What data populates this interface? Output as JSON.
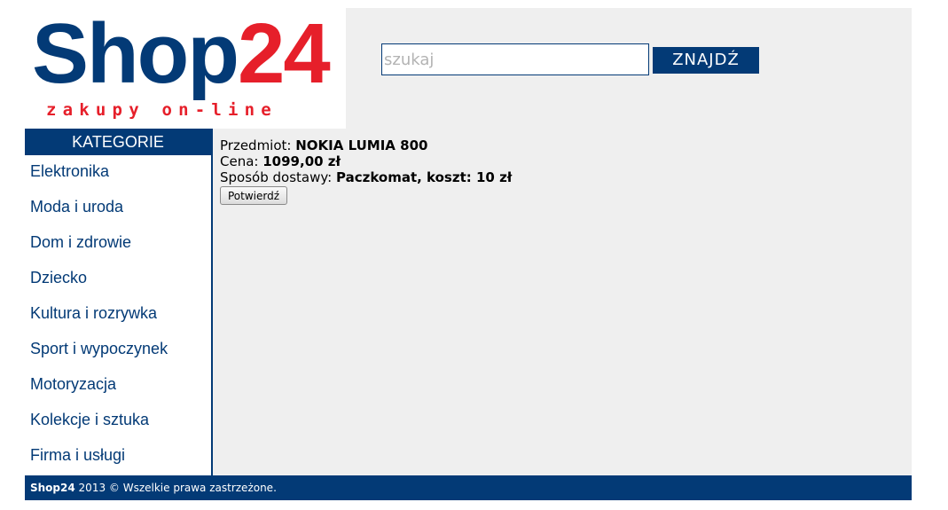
{
  "logo": {
    "name_part": "Shop",
    "number_part": "24",
    "tagline": "zakupy on-line",
    "colors": {
      "blue": "#033a76",
      "red": "#e61f2a"
    }
  },
  "search": {
    "placeholder": "szukaj",
    "value": "",
    "button_label": "ZNAJDŹ"
  },
  "sidebar": {
    "title": "KATEGORIE",
    "items": [
      {
        "label": "Elektronika"
      },
      {
        "label": "Moda i uroda"
      },
      {
        "label": "Dom i zdrowie"
      },
      {
        "label": "Dziecko"
      },
      {
        "label": "Kultura i rozrywka"
      },
      {
        "label": "Sport i wypoczynek"
      },
      {
        "label": "Motoryzacja"
      },
      {
        "label": "Kolekcje i sztuka"
      },
      {
        "label": "Firma i usługi"
      }
    ]
  },
  "order": {
    "item_label": "Przedmiot:",
    "item_value": "NOKIA LUMIA 800",
    "price_label": "Cena:",
    "price_value": "1099,00 zł",
    "delivery_label": "Sposób dostawy:",
    "delivery_value": "Paczkomat, koszt: 10 zł",
    "confirm_label": "Potwierdź"
  },
  "footer": {
    "brand": "Shop24",
    "text": "2013 © Wszelkie prawa zastrzeżone."
  },
  "colors": {
    "primary": "#033a76",
    "accent": "#e61f2a",
    "panel_bg": "#efefef"
  }
}
